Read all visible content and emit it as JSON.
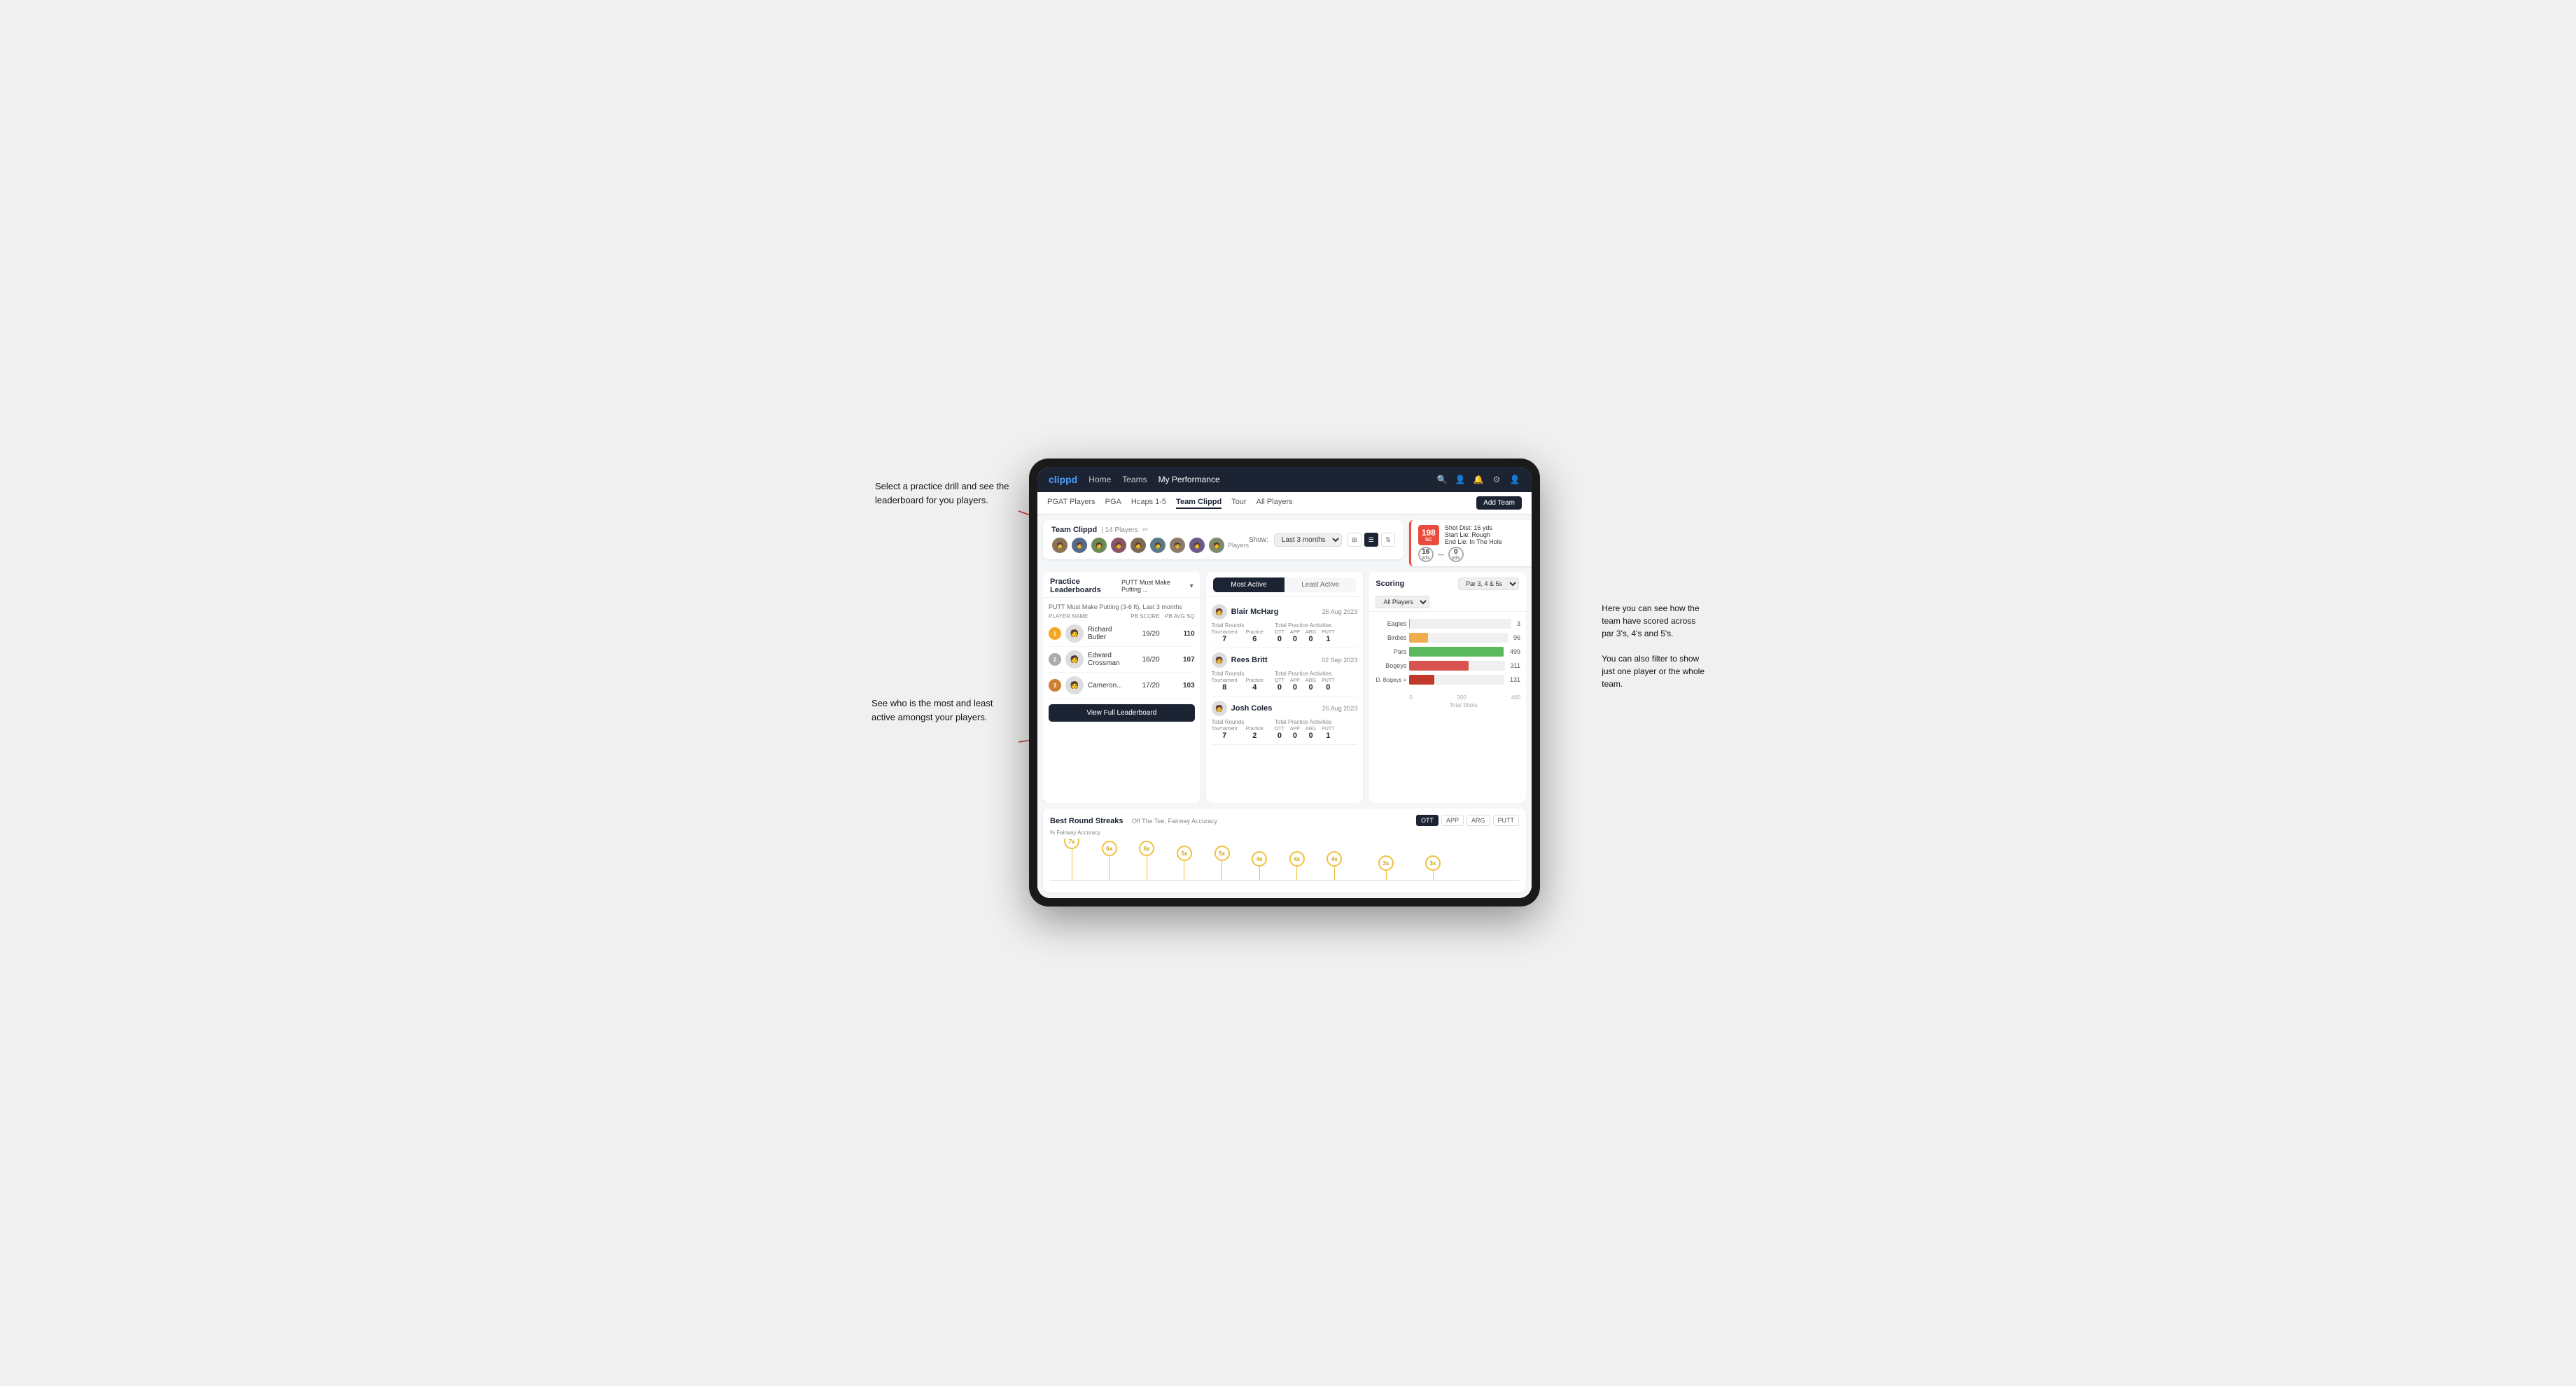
{
  "annotations": {
    "top_left": "Select a practice drill and see\nthe leaderboard for you players.",
    "bottom_left": "See who is the most and least\nactive amongst your players.",
    "right": "Here you can see how the\nteam have scored across\npar 3's, 4's and 5's.\n\nYou can also filter to show\njust one player or the whole\nteam."
  },
  "nav": {
    "logo": "clippd",
    "links": [
      "Home",
      "Teams",
      "My Performance"
    ],
    "icons": [
      "search",
      "person",
      "bell",
      "settings",
      "user"
    ]
  },
  "subnav": {
    "links": [
      "PGAT Players",
      "PGA",
      "Hcaps 1-5",
      "Team Clippd",
      "Tour",
      "All Players"
    ],
    "active": "Team Clippd",
    "add_team": "Add Team"
  },
  "team_header": {
    "title": "Team Clippd",
    "player_count": "14 Players",
    "show_label": "Show:",
    "show_value": "Last 3 months",
    "players_label": "Players"
  },
  "shot_info": {
    "badge": "198",
    "badge_sub": "SC",
    "details_line1": "Shot Dist: 16 yds",
    "details_line2": "Start Lie: Rough",
    "details_line3": "End Lie: In The Hole",
    "circle1_val": "16",
    "circle1_unit": "yds",
    "circle2_val": "0",
    "circle2_unit": "yds"
  },
  "leaderboard": {
    "title": "Practice Leaderboards",
    "dropdown": "PUTT Must Make Putting ...",
    "subtitle_prefix": "PUTT Must Make Putting (3-6 ft),",
    "subtitle_period": "Last 3 months",
    "col_player": "PLAYER NAME",
    "col_pb": "PB SCORE",
    "col_avg": "PB AVG SQ",
    "players": [
      {
        "rank": 1,
        "name": "Richard Butler",
        "score": "19/20",
        "avg": "110"
      },
      {
        "rank": 2,
        "name": "Edward Crossman",
        "score": "18/20",
        "avg": "107"
      },
      {
        "rank": 3,
        "name": "Cameron...",
        "score": "17/20",
        "avg": "103"
      }
    ],
    "view_button": "View Full Leaderboard"
  },
  "activity": {
    "tabs": [
      "Most Active",
      "Least Active"
    ],
    "active_tab": "Most Active",
    "players": [
      {
        "name": "Blair McHarg",
        "date": "26 Aug 2023",
        "total_rounds_label": "Total Rounds",
        "tournament": "7",
        "practice": "6",
        "practice_activities_label": "Total Practice Activities",
        "ott": "0",
        "app": "0",
        "arg": "0",
        "putt": "1"
      },
      {
        "name": "Rees Britt",
        "date": "02 Sep 2023",
        "total_rounds_label": "Total Rounds",
        "tournament": "8",
        "practice": "4",
        "practice_activities_label": "Total Practice Activities",
        "ott": "0",
        "app": "0",
        "arg": "0",
        "putt": "0"
      },
      {
        "name": "Josh Coles",
        "date": "26 Aug 2023",
        "total_rounds_label": "Total Rounds",
        "tournament": "7",
        "practice": "2",
        "practice_activities_label": "Total Practice Activities",
        "ott": "0",
        "app": "0",
        "arg": "0",
        "putt": "1"
      }
    ]
  },
  "scoring": {
    "title": "Scoring",
    "par_filter": "Par 3, 4 & 5s",
    "player_filter": "All Players",
    "bars": [
      {
        "label": "Eagles",
        "value": 3,
        "max": 500,
        "color": "eagles"
      },
      {
        "label": "Birdies",
        "value": 96,
        "max": 500,
        "color": "birdies"
      },
      {
        "label": "Pars",
        "value": 499,
        "max": 500,
        "color": "pars"
      },
      {
        "label": "Bogeys",
        "value": 311,
        "max": 500,
        "color": "bogeys"
      },
      {
        "label": "D. Bogeys +",
        "value": 131,
        "max": 500,
        "color": "dbogeys"
      }
    ],
    "axis_labels": [
      "0",
      "200",
      "400"
    ],
    "axis_title": "Total Shots"
  },
  "streaks": {
    "title": "Best Round Streaks",
    "subtitle": "Off The Tee, Fairway Accuracy",
    "filter_buttons": [
      "OTT",
      "APP",
      "ARG",
      "PUTT"
    ],
    "active_filter": "OTT",
    "points": [
      {
        "x": 8,
        "label": "7x",
        "height": 55
      },
      {
        "x": 15,
        "label": "6x",
        "height": 42
      },
      {
        "x": 22,
        "label": "6x",
        "height": 42
      },
      {
        "x": 29,
        "label": "5x",
        "height": 35
      },
      {
        "x": 36,
        "label": "5x",
        "height": 35
      },
      {
        "x": 43,
        "label": "4x",
        "height": 25
      },
      {
        "x": 50,
        "label": "4x",
        "height": 25
      },
      {
        "x": 57,
        "label": "4x",
        "height": 25
      },
      {
        "x": 64,
        "label": "3x",
        "height": 18
      },
      {
        "x": 71,
        "label": "3x",
        "height": 18
      }
    ]
  }
}
